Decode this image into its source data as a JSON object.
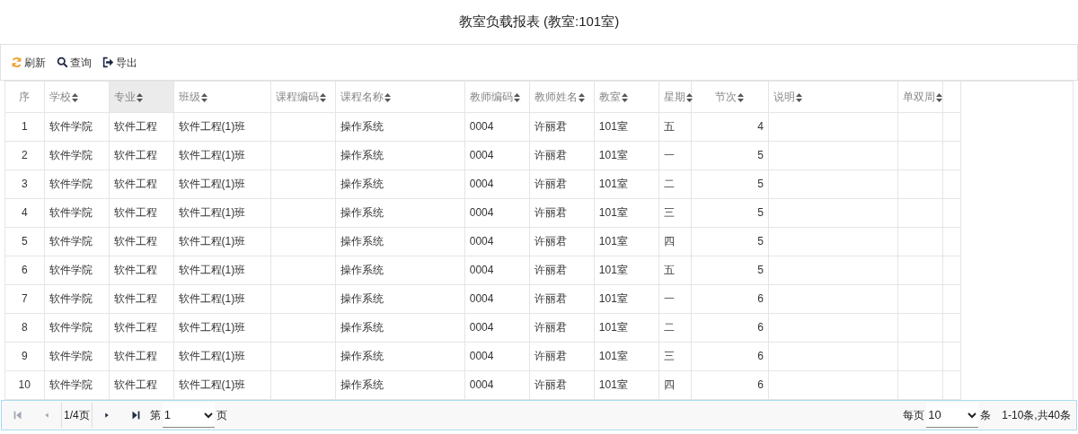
{
  "title": "教室负载报表 (教室:101室)",
  "toolbar": [
    {
      "kind": "refresh",
      "label": "刷新"
    },
    {
      "kind": "search",
      "label": "查询"
    },
    {
      "kind": "export",
      "label": "导出"
    }
  ],
  "table": {
    "columns": [
      {
        "label": "序",
        "sortable": false,
        "selected": false,
        "kind": "index"
      },
      {
        "label": "学校",
        "sortable": true,
        "selected": false,
        "kind": "text"
      },
      {
        "label": "专业",
        "sortable": true,
        "selected": true,
        "kind": "text"
      },
      {
        "label": "班级",
        "sortable": true,
        "selected": false,
        "kind": "text"
      },
      {
        "label": "课程编码",
        "sortable": true,
        "selected": false,
        "kind": "text"
      },
      {
        "label": "课程名称",
        "sortable": true,
        "selected": false,
        "kind": "text"
      },
      {
        "label": "教师编码",
        "sortable": true,
        "selected": false,
        "kind": "text"
      },
      {
        "label": "教师姓名",
        "sortable": true,
        "selected": false,
        "kind": "text"
      },
      {
        "label": "教室",
        "sortable": true,
        "selected": false,
        "kind": "text"
      },
      {
        "label": "星期",
        "sortable": true,
        "selected": false,
        "kind": "text"
      },
      {
        "label": "节次",
        "sortable": true,
        "selected": false,
        "kind": "number"
      },
      {
        "label": "说明",
        "sortable": true,
        "selected": false,
        "kind": "text"
      },
      {
        "label": "单双周",
        "sortable": true,
        "selected": false,
        "kind": "text"
      }
    ],
    "rows": [
      [
        "1",
        "软件学院",
        "软件工程",
        "软件工程(1)班",
        "",
        "操作系统",
        "0004",
        "许丽君",
        "101室",
        "五",
        "4",
        "",
        ""
      ],
      [
        "2",
        "软件学院",
        "软件工程",
        "软件工程(1)班",
        "",
        "操作系统",
        "0004",
        "许丽君",
        "101室",
        "一",
        "5",
        "",
        ""
      ],
      [
        "3",
        "软件学院",
        "软件工程",
        "软件工程(1)班",
        "",
        "操作系统",
        "0004",
        "许丽君",
        "101室",
        "二",
        "5",
        "",
        ""
      ],
      [
        "4",
        "软件学院",
        "软件工程",
        "软件工程(1)班",
        "",
        "操作系统",
        "0004",
        "许丽君",
        "101室",
        "三",
        "5",
        "",
        ""
      ],
      [
        "5",
        "软件学院",
        "软件工程",
        "软件工程(1)班",
        "",
        "操作系统",
        "0004",
        "许丽君",
        "101室",
        "四",
        "5",
        "",
        ""
      ],
      [
        "6",
        "软件学院",
        "软件工程",
        "软件工程(1)班",
        "",
        "操作系统",
        "0004",
        "许丽君",
        "101室",
        "五",
        "5",
        "",
        ""
      ],
      [
        "7",
        "软件学院",
        "软件工程",
        "软件工程(1)班",
        "",
        "操作系统",
        "0004",
        "许丽君",
        "101室",
        "一",
        "6",
        "",
        ""
      ],
      [
        "8",
        "软件学院",
        "软件工程",
        "软件工程(1)班",
        "",
        "操作系统",
        "0004",
        "许丽君",
        "101室",
        "二",
        "6",
        "",
        ""
      ],
      [
        "9",
        "软件学院",
        "软件工程",
        "软件工程(1)班",
        "",
        "操作系统",
        "0004",
        "许丽君",
        "101室",
        "三",
        "6",
        "",
        ""
      ],
      [
        "10",
        "软件学院",
        "软件工程",
        "软件工程(1)班",
        "",
        "操作系统",
        "0004",
        "许丽君",
        "101室",
        "四",
        "6",
        "",
        ""
      ]
    ]
  },
  "pager": {
    "nav_start": [
      {
        "kind": "first",
        "disabled": true
      },
      {
        "kind": "prev",
        "disabled": true
      }
    ],
    "page_info": "1/4页",
    "nav_end": [
      {
        "kind": "next",
        "disabled": false
      },
      {
        "kind": "last",
        "disabled": false
      }
    ],
    "page_prefix": "第",
    "page_value": "1",
    "page_suffix": "页",
    "size_prefix": "每页",
    "size_value": "10",
    "size_suffix": "条",
    "summary": "1-10条,共40条"
  }
}
